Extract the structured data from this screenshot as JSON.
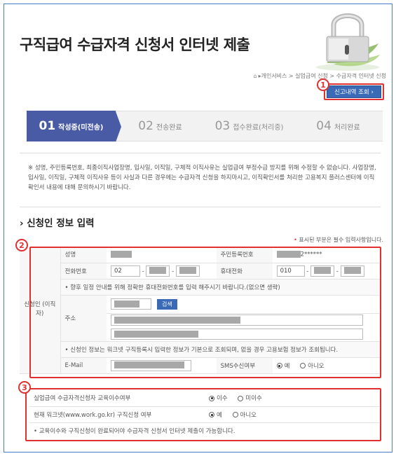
{
  "page": {
    "title": "구직급여 수급자격 신청서 인터넷 제출"
  },
  "breadcrumb": "▸개인서비스 > 실업급여 신청 > 수급자격 인터넷 신청",
  "inquiry_button": "신고내역 조회 ›",
  "annotations": [
    "1",
    "2",
    "3"
  ],
  "steps": [
    {
      "num": "01",
      "label": "작성중(미전송)"
    },
    {
      "num": "02",
      "label": "전송완료"
    },
    {
      "num": "03",
      "label": "접수완료(처리중)"
    },
    {
      "num": "04",
      "label": "처리완료"
    }
  ],
  "notice": "※ 성명, 주민등록번호, 최종이직사업장명, 입사일, 이직일, 구체적 이직사유는 실업급여 부정수급 방지를 위해 수정할 수 없습니다. 사업장명, 입사일, 이직일, 구체적 이직사유 등이 사실과 다른 경우에는 수급자격 신청을 하지마시고, 이직확인서를 처리한 고용복지 플러스센터에 이직확인서 내용에 대해 문의하시기 바랍니다.",
  "section_title": "› 신청인 정보 입력",
  "required_note": {
    "star": "•",
    "text": " 표시된 부분은 필수 입력사항입니다."
  },
  "form": {
    "side_label": "신청인 (이직자)",
    "name_label": "성명",
    "rrn_label": "주민등록번호",
    "rrn_suffix": "2******",
    "phone_label": "전화번호",
    "phone_prefix": "02",
    "mobile_label": "휴대전화",
    "mobile_prefix": "010",
    "phone_note": "• 향후 일정 안내를 위해 정확한 휴대전화번호를 입력 해주시기 바랍니다.(없으면 생략)",
    "address_label": "주소",
    "search_button": "검색",
    "info_note": "• 신청인 정보는 워크넷 구직등록시 입력한 정보가 기본으로 조회되며, 없을 경우 고용보험 정보가 조회됩니다.",
    "email_label": "E-Mail",
    "sms_label": "SMS수신여부",
    "sms_yes": "예",
    "sms_no": "아니오"
  },
  "education": {
    "edu_label": "실업급여 수급자격신청자 교육이수여부",
    "edu_yes": "이수",
    "edu_no": "미이수",
    "worknet_label": "현재 워크넷(www.work.go.kr) 구직신청 여부",
    "worknet_yes": "예",
    "worknet_no": "아니오",
    "footer_note": "• 교육이수와 구직신청이 완료되어야 수급자격 신청서 인터넷 제출이 가능합니다."
  }
}
